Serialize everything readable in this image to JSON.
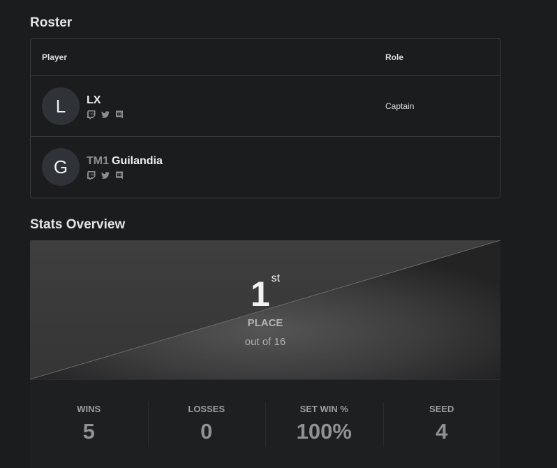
{
  "roster": {
    "title": "Roster",
    "headers": {
      "player": "Player",
      "role": "Role"
    },
    "rows": [
      {
        "initial": "L",
        "tag": "",
        "name": "LX",
        "role": "Captain",
        "socials": [
          "twitch-icon",
          "twitter-icon",
          "discord-icon"
        ]
      },
      {
        "initial": "G",
        "tag": "TM1",
        "name": "Guilandia",
        "role": "",
        "socials": [
          "twitch-icon",
          "twitter-icon",
          "discord-icon"
        ]
      }
    ]
  },
  "stats": {
    "title": "Stats Overview",
    "place": "1",
    "place_suffix": "st",
    "place_label": "PLACE",
    "out_of": "out of 16",
    "items": [
      {
        "label": "WINS",
        "value": "5"
      },
      {
        "label": "LOSSES",
        "value": "0"
      },
      {
        "label": "SET WIN %",
        "value": "100%"
      },
      {
        "label": "SEED",
        "value": "4"
      }
    ]
  },
  "colors": {
    "background": "#1b1c1e",
    "border": "#3a3b3e",
    "icon": "#8a8c90"
  }
}
